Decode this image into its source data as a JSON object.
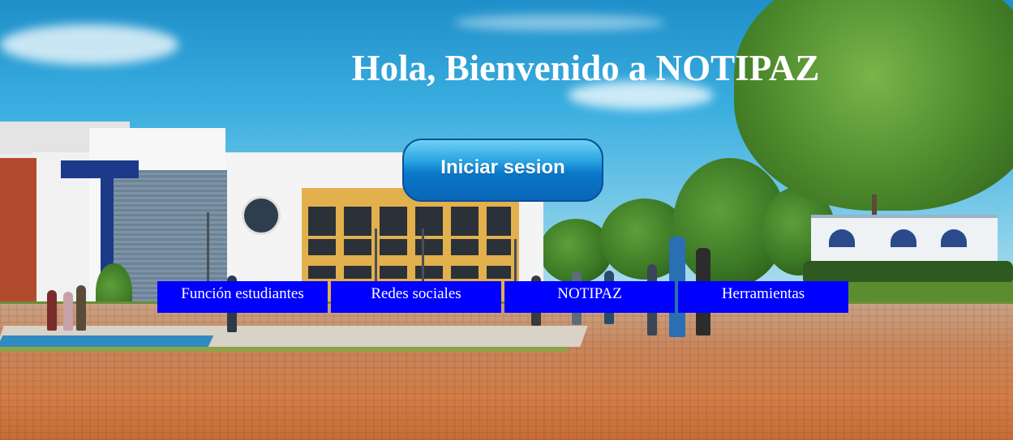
{
  "page": {
    "title": "Hola, Bienvenido a NOTIPAZ"
  },
  "login": {
    "label": "Iniciar sesion"
  },
  "nav": {
    "items": [
      {
        "label": "Función estudiantes"
      },
      {
        "label": "Redes sociales"
      },
      {
        "label": "NOTIPAZ"
      },
      {
        "label": "Herramientas"
      }
    ]
  },
  "colors": {
    "nav_background": "#0000ff",
    "nav_text": "#ffffff",
    "title_text": "#ffffff",
    "login_button_top": "#6fd2f5",
    "login_button_bottom": "#0a66b8"
  },
  "background": {
    "icon": "campus-photo"
  }
}
